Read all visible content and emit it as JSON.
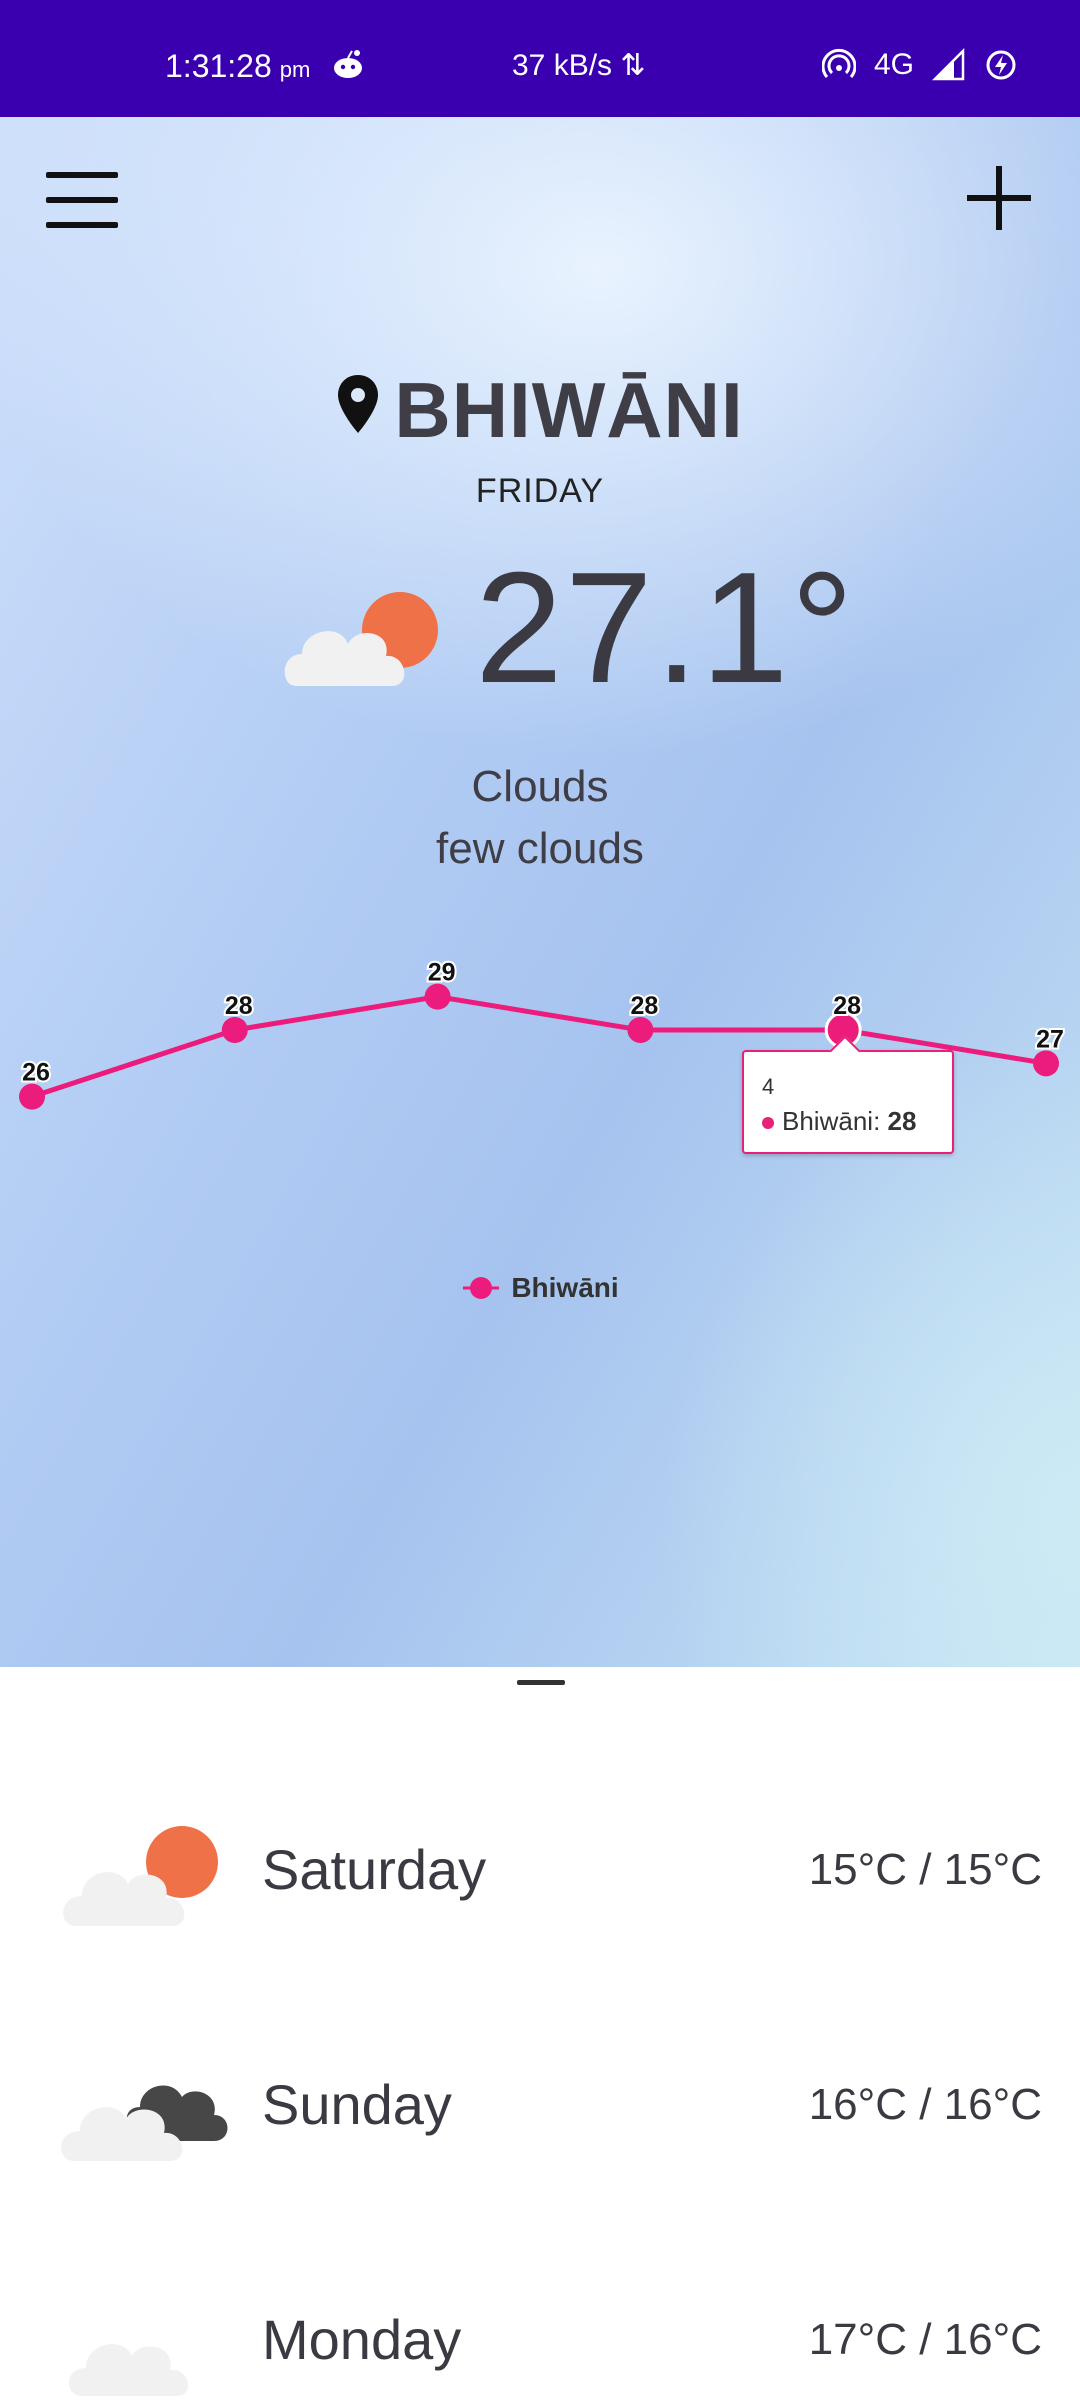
{
  "status_bar": {
    "time": "1:31:28",
    "ampm": "pm",
    "net_speed": "37 kB/s",
    "network": "4G"
  },
  "header": {
    "city": "BHIWĀNI",
    "day": "FRIDAY"
  },
  "current": {
    "temperature": "27.1°",
    "condition": "Clouds",
    "description": "few clouds",
    "icon": "partly-cloudy-icon"
  },
  "chart_data": {
    "type": "line",
    "x": [
      0,
      1,
      2,
      3,
      4,
      5
    ],
    "series": [
      {
        "name": "Bhiwāni",
        "values": [
          26,
          28,
          29,
          28,
          28,
          27
        ],
        "color": "#ec1c7c"
      }
    ],
    "data_labels": [
      "26",
      "28",
      "29",
      "28",
      "28",
      "27"
    ],
    "ylim": [
      22,
      31
    ],
    "legend": "bottom-center",
    "tooltip": {
      "x_label": "4",
      "series": "Bhiwāni",
      "value": "28"
    }
  },
  "forecast": [
    {
      "day": "Saturday",
      "temps": "15°C / 15°C",
      "icon": "partly-cloudy-icon"
    },
    {
      "day": "Sunday",
      "temps": "16°C / 16°C",
      "icon": "dark-clouds-icon"
    },
    {
      "day": "Monday",
      "temps": "17°C / 16°C",
      "icon": "cloud-icon"
    }
  ],
  "colors": {
    "status_bar": "#3a00b0",
    "accent": "#ec1c7c",
    "sun": "#ef7147",
    "text": "#3b3a42"
  }
}
